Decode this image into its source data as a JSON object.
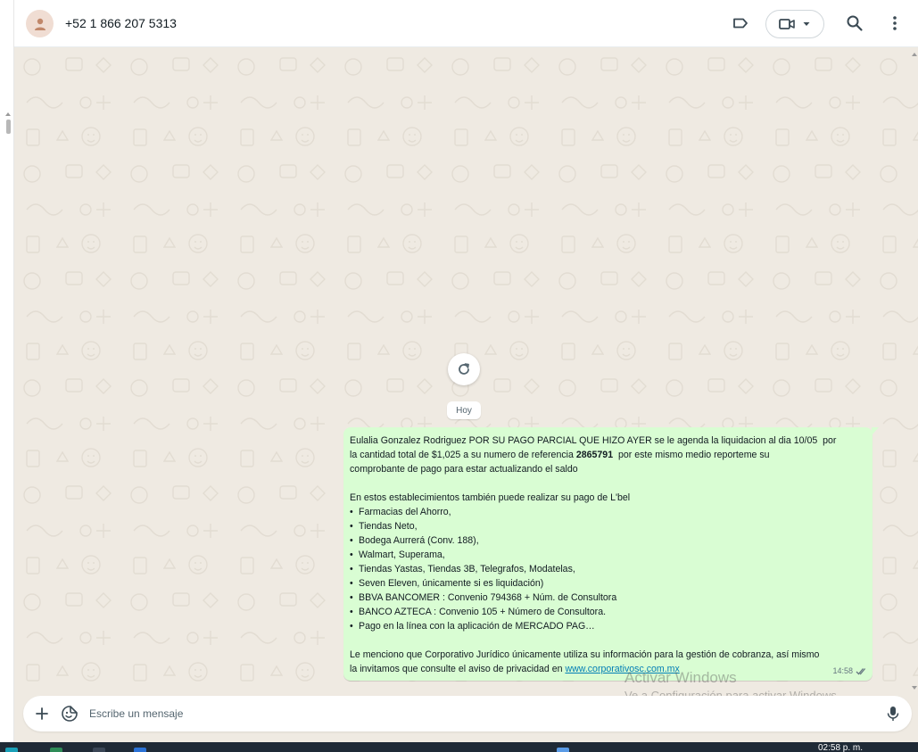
{
  "header": {
    "contact_name": "+52 1 866 207 5313",
    "icons": [
      "avatar-person-icon",
      "label-icon",
      "video-call-icon",
      "chevron-down-icon",
      "search-icon",
      "more-vertical-icon"
    ]
  },
  "chat": {
    "date_chip": "Hoy",
    "refresh_icon": "refresh-icon",
    "message": {
      "line1_prefix": "Eulalia Gonzalez Rodriguez POR SU PAGO PARCIAL QUE HIZO AYER se le agenda la liquidacion al dia 10/05  por",
      "line2_prefix": "la cantidad total de $1,025 a su numero de referencia ",
      "reference": "2865791",
      "line2_suffix": "  por este mismo medio reporteme su",
      "line3": "comprobante de pago para estar actualizando el saldo",
      "list_intro": "En estos establecimientos también puede realizar su pago de L'bel",
      "bullet": "•",
      "items": [
        "Farmacias del Ahorro,",
        "Tiendas Neto,",
        "Bodega Aurrerá (Conv. 188),",
        "Walmart, Superama,",
        "Tiendas Yastas, Tiendas 3B, Telegrafos, Modatelas,",
        "Seven Eleven, únicamente si es liquidación)",
        "BBVA BANCOMER : Convenio 794368 + Núm. de Consultora",
        "BANCO AZTECA : Convenio 105 + Número de Consultora.",
        "Pago en la línea con la aplicación de MERCADO PAG…"
      ],
      "closing_line1": "Le menciono que Corporativo Jurídico únicamente utiliza su información para la gestión de cobranza, así mismo",
      "closing_line2_prefix": "la invitamos que consulte el aviso de privacidad en ",
      "link": "www.corporativosc.com.mx",
      "time": "14:58",
      "status_icon": "double-check-icon"
    }
  },
  "watermark": {
    "line1": "Activar Windows",
    "line2": "Ve a Configuración para activar Windows."
  },
  "composer": {
    "placeholder": "Escribe un mensaje",
    "icons": [
      "plus-icon",
      "sticker-icon",
      "microphone-icon"
    ]
  },
  "taskbar": {
    "time": "02:58 p. m."
  },
  "colors": {
    "chat_background": "#efeae2",
    "outgoing_bubble": "#d9fdd3",
    "link": "#027eb5",
    "taskbar": "#1f2a36"
  }
}
